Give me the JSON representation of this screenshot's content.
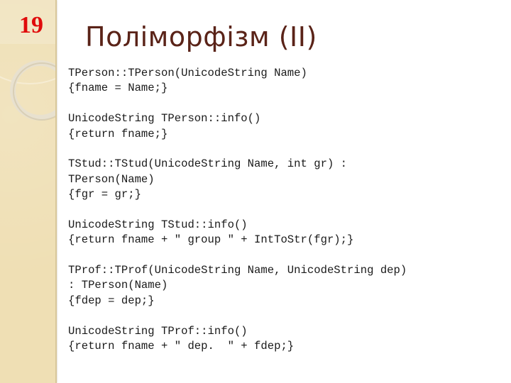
{
  "slide": {
    "number": "19",
    "title": "Поліморфізм (II)",
    "code_lines": [
      "TPerson::TPerson(UnicodeString Name)",
      "{fname = Name;}",
      "",
      "UnicodeString TPerson::info()",
      "{return fname;}",
      "",
      "TStud::TStud(UnicodeString Name, int gr) :",
      "TPerson(Name)",
      "{fgr = gr;}",
      "",
      "UnicodeString TStud::info()",
      "{return fname + \" group \" + IntToStr(fgr);}",
      "",
      "TProf::TProf(UnicodeString Name, UnicodeString dep)",
      ": TPerson(Name)",
      "{fdep = dep;}",
      "",
      "UnicodeString TProf::info()",
      "{return fname + \" dep.  \" + fdep;}"
    ]
  },
  "colors": {
    "slide_number": "#e00b0b",
    "title": "#5a2318",
    "sidebar": "#efdfb4"
  }
}
